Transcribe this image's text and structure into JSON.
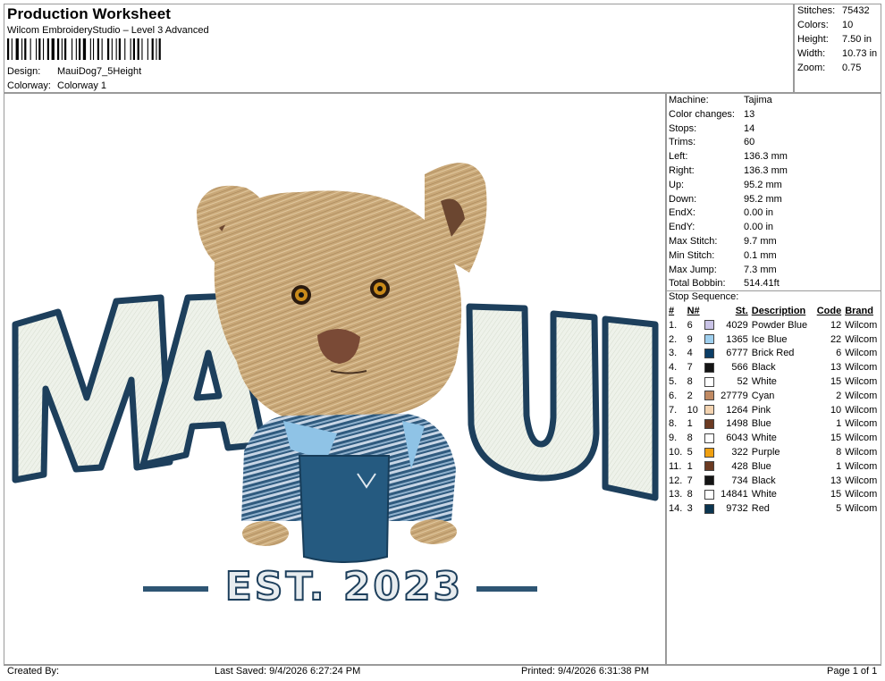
{
  "header": {
    "title": "Production Worksheet",
    "software": "Wilcom EmbroideryStudio – Level 3 Advanced",
    "design_label": "Design:",
    "design_value": "MauiDog7_5Height",
    "colorway_label": "Colorway:",
    "colorway_value": "Colorway 1"
  },
  "stats": [
    {
      "label": "Stitches:",
      "value": "75432"
    },
    {
      "label": "Colors:",
      "value": "10"
    },
    {
      "label": "Height:",
      "value": "7.50 in"
    },
    {
      "label": "Width:",
      "value": "10.73 in"
    },
    {
      "label": "Zoom:",
      "value": "0.75"
    }
  ],
  "machine_info": [
    {
      "label": "Machine:",
      "value": "Tajima"
    },
    {
      "label": "Color changes:",
      "value": "13"
    },
    {
      "label": "Stops:",
      "value": "14"
    },
    {
      "label": "Trims:",
      "value": "60"
    },
    {
      "label": "Left:",
      "value": "136.3 mm"
    },
    {
      "label": "Right:",
      "value": "136.3 mm"
    },
    {
      "label": "Up:",
      "value": "95.2 mm"
    },
    {
      "label": "Down:",
      "value": "95.2 mm"
    },
    {
      "label": "EndX:",
      "value": "0.00 in"
    },
    {
      "label": "EndY:",
      "value": "0.00 in"
    },
    {
      "label": "Max Stitch:",
      "value": "9.7 mm"
    },
    {
      "label": "Min Stitch:",
      "value": "0.1 mm"
    },
    {
      "label": "Max Jump:",
      "value": "7.3 mm"
    },
    {
      "label": "Total Bobbin:",
      "value": "514.41ft"
    }
  ],
  "stop_sequence": {
    "heading": "Stop Sequence:",
    "columns": [
      "#",
      "N#",
      "St.",
      "Description",
      "Code",
      "Brand"
    ],
    "rows": [
      {
        "idx": "1.",
        "n": "6",
        "color": "#c9c3e6",
        "st": "4029",
        "desc": "Powder Blue",
        "code": "12",
        "brand": "Wilcom"
      },
      {
        "idx": "2.",
        "n": "9",
        "color": "#9fd0ef",
        "st": "1365",
        "desc": "Ice Blue",
        "code": "22",
        "brand": "Wilcom"
      },
      {
        "idx": "3.",
        "n": "4",
        "color": "#0b3d66",
        "st": "6777",
        "desc": "Brick Red",
        "code": "6",
        "brand": "Wilcom"
      },
      {
        "idx": "4.",
        "n": "7",
        "color": "#141414",
        "st": "566",
        "desc": "Black",
        "code": "13",
        "brand": "Wilcom"
      },
      {
        "idx": "5.",
        "n": "8",
        "color": "#ffffff",
        "st": "52",
        "desc": "White",
        "code": "15",
        "brand": "Wilcom"
      },
      {
        "idx": "6.",
        "n": "2",
        "color": "#c08a63",
        "st": "27779",
        "desc": "Cyan",
        "code": "2",
        "brand": "Wilcom"
      },
      {
        "idx": "7.",
        "n": "10",
        "color": "#f3d3b0",
        "st": "1264",
        "desc": "Pink",
        "code": "10",
        "brand": "Wilcom"
      },
      {
        "idx": "8.",
        "n": "1",
        "color": "#6b3a22",
        "st": "1498",
        "desc": "Blue",
        "code": "1",
        "brand": "Wilcom"
      },
      {
        "idx": "9.",
        "n": "8",
        "color": "#ffffff",
        "st": "6043",
        "desc": "White",
        "code": "15",
        "brand": "Wilcom"
      },
      {
        "idx": "10.",
        "n": "5",
        "color": "#f0a010",
        "st": "322",
        "desc": "Purple",
        "code": "8",
        "brand": "Wilcom"
      },
      {
        "idx": "11.",
        "n": "1",
        "color": "#6b3a22",
        "st": "428",
        "desc": "Blue",
        "code": "1",
        "brand": "Wilcom"
      },
      {
        "idx": "12.",
        "n": "7",
        "color": "#141414",
        "st": "734",
        "desc": "Black",
        "code": "13",
        "brand": "Wilcom"
      },
      {
        "idx": "13.",
        "n": "8",
        "color": "#ffffff",
        "st": "14841",
        "desc": "White",
        "code": "15",
        "brand": "Wilcom"
      },
      {
        "idx": "14.",
        "n": "3",
        "color": "#0b3550",
        "st": "9732",
        "desc": "Red",
        "code": "5",
        "brand": "Wilcom"
      }
    ]
  },
  "design": {
    "text_left": "MA",
    "text_right": "UI",
    "est_text": "EST. 2023"
  },
  "footer": {
    "created_by": "Created By:",
    "last_saved": "Last Saved: 9/4/2026 6:27:24 PM",
    "printed": "Printed: 9/4/2026 6:31:38 PM",
    "page": "Page 1 of 1"
  }
}
